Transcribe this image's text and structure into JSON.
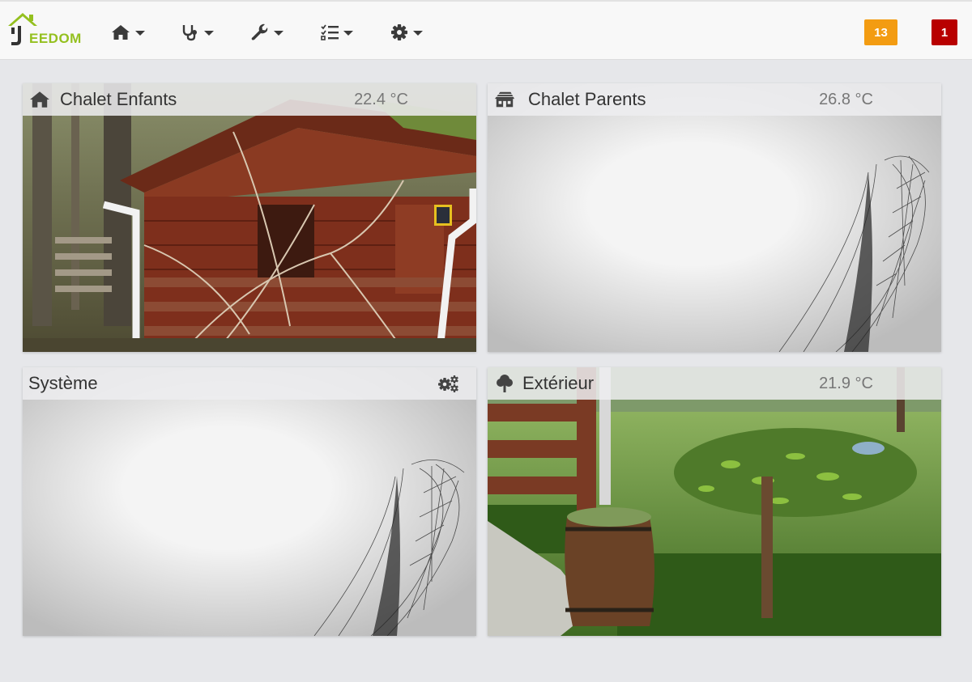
{
  "header": {
    "logo": {
      "text": "EEDOM",
      "icon": "jeedom-house-logo"
    },
    "menus": [
      {
        "icon": "home-icon",
        "label": ""
      },
      {
        "icon": "stethoscope-icon",
        "label": ""
      },
      {
        "icon": "wrench-icon",
        "label": ""
      },
      {
        "icon": "tasks-list-icon",
        "label": ""
      },
      {
        "icon": "cog-icon",
        "label": ""
      }
    ],
    "badges": {
      "messages": {
        "count": "13",
        "color": "#f39c12"
      },
      "alerts": {
        "count": "1",
        "color": "#b80000"
      }
    }
  },
  "tiles": [
    {
      "title": "Chalet Enfants",
      "temperature": "22.4 °C",
      "icon": "home-icon",
      "background": "wooden-chalet-photo"
    },
    {
      "title": "Chalet Parents",
      "temperature": "26.8 °C",
      "icon": "cabin-icon",
      "background": "default-feather-background"
    },
    {
      "title": "Système",
      "temperature": "",
      "icon": "",
      "action_icon": "cogs-icon",
      "background": "default-feather-background"
    },
    {
      "title": "Extérieur",
      "temperature": "21.9 °C",
      "icon": "tree-icon",
      "background": "garden-pond-photo"
    }
  ],
  "colors": {
    "logo_green": "#94c01f",
    "page_background": "#e6e7ea"
  }
}
